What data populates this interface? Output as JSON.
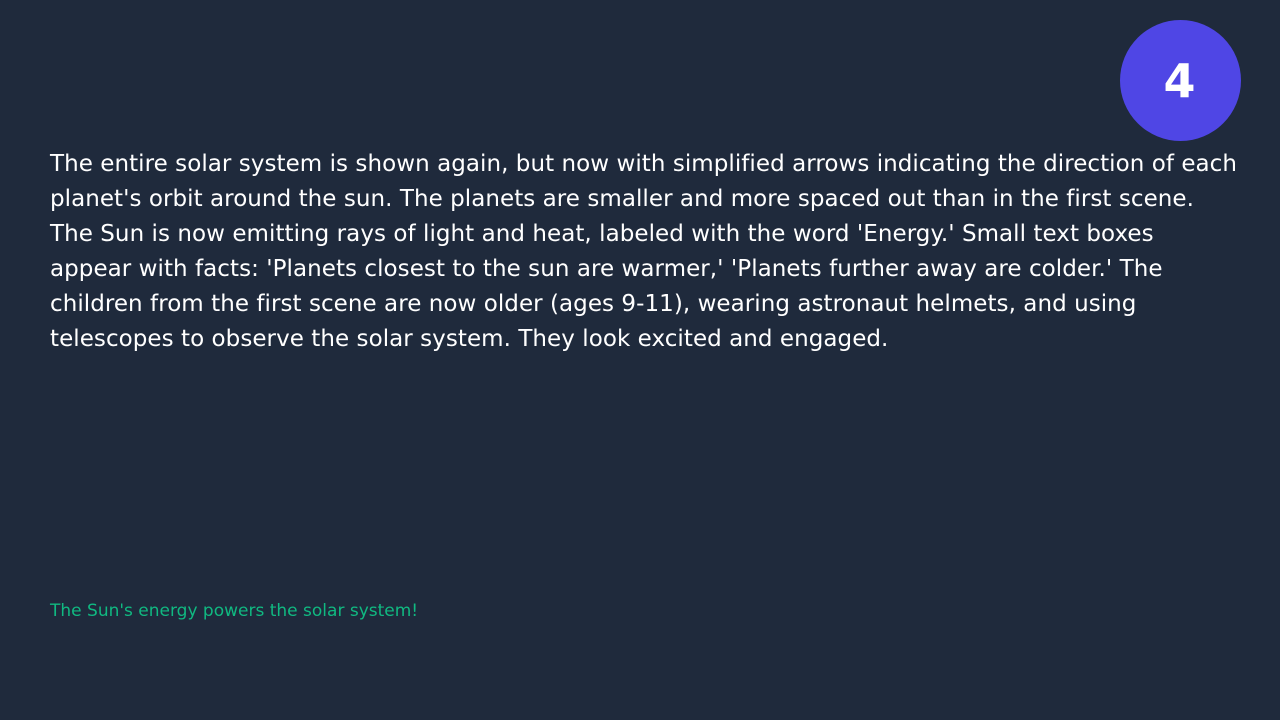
{
  "scene": {
    "number": "4",
    "badge_color": "#4f46e5",
    "description": "The entire solar system is shown again, but now with simplified arrows indicating the direction of each planet's orbit around the sun. The planets are smaller and more spaced out than in the first scene. The Sun is now emitting rays of light and heat, labeled with the word 'Energy.' Small text boxes appear with facts: 'Planets closest to the sun are warmer,' 'Planets further away are colder.' The children from the first scene are now older (ages 9-11), wearing astronaut helmets, and using telescopes to observe the solar system. They look excited and engaged.",
    "caption": "The Sun's energy powers the solar system!",
    "caption_color": "#10b981"
  },
  "theme": {
    "background": "#1f2a3c",
    "text_color": "#ffffff"
  }
}
